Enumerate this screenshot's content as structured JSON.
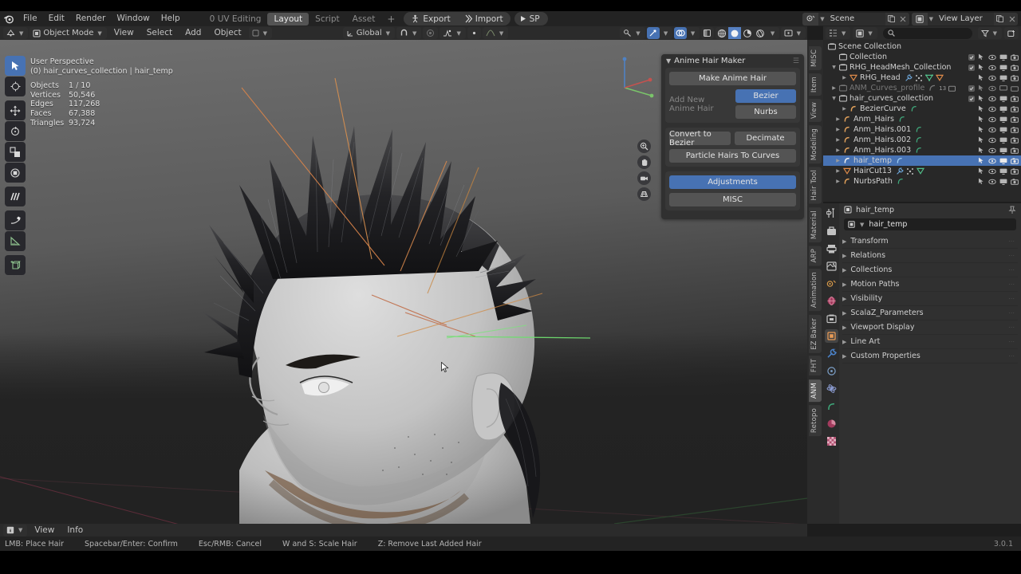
{
  "app": {
    "name": "Blender",
    "version": "3.0.1"
  },
  "topbar": {
    "logo_icon": "blender-logo-icon",
    "menus": [
      "File",
      "Edit",
      "Render",
      "Window",
      "Help"
    ],
    "workspace_tabs": [
      {
        "label": "0 UV Editing",
        "active": false
      },
      {
        "label": "Layout",
        "active": true
      },
      {
        "label": "Script",
        "active": false
      },
      {
        "label": "Asset",
        "active": false
      }
    ],
    "add_workspace": "+",
    "export_label": "Export",
    "import_label": "Import",
    "sp_label": "SP",
    "scene": {
      "label": "Scene",
      "icon": "scene-icon",
      "new_icon": "duplicate-icon",
      "unlink_icon": "close-icon"
    },
    "view_layer": {
      "label": "View Layer",
      "icon": "view-layer-icon",
      "new_icon": "duplicate-icon",
      "unlink_icon": "close-icon"
    }
  },
  "viewheader": {
    "editor_type_icon": "editor-type-icon",
    "mode": "Object Mode",
    "menus": [
      "View",
      "Select",
      "Add",
      "Object"
    ],
    "transform_orientation": "Global",
    "snap_icon": "magnet-icon",
    "proportional_icon": "proportional-edit-icon",
    "proportional_falloff_icon": "falloff-icon",
    "visibility_icon": "visibility-icon",
    "gizmo_icon": "gizmo-icon",
    "overlays_icon": "overlays-icon",
    "xray_icon": "xray-icon",
    "shading": [
      "wireframe",
      "solid",
      "material-preview",
      "rendered"
    ],
    "shading_active": "solid"
  },
  "viewport": {
    "perspective": "User Perspective",
    "context": "(0) hair_curves_collection | hair_temp",
    "stats": [
      {
        "label": "Objects",
        "value": "1 / 10"
      },
      {
        "label": "Vertices",
        "value": "50,546"
      },
      {
        "label": "Edges",
        "value": "117,268"
      },
      {
        "label": "Faces",
        "value": "67,388"
      },
      {
        "label": "Triangles",
        "value": "93,724"
      }
    ],
    "tools": [
      "tweak-select-tool",
      "cursor-tool",
      "move-tool",
      "rotate-tool",
      "scale-tool",
      "transform-tool",
      "annotate-tool",
      "measure-tool",
      "ruler-tool",
      "add-cube-tool"
    ],
    "nav_buttons": [
      "zoom-icon",
      "pan-hand-icon",
      "camera-view-icon",
      "toggle-perspective-icon"
    ],
    "gizmo_axes": [
      "x",
      "y",
      "z"
    ]
  },
  "vtabs": {
    "items": [
      {
        "label": "MISC",
        "active": false
      },
      {
        "label": "Item",
        "active": false
      },
      {
        "label": "View",
        "active": false
      },
      {
        "label": "Modeling",
        "active": false
      },
      {
        "label": "Hair Tool",
        "active": false
      },
      {
        "label": "Material",
        "active": false
      },
      {
        "label": "ARP",
        "active": false
      },
      {
        "label": "Animation",
        "active": false
      },
      {
        "label": "EZ Baker",
        "active": false
      },
      {
        "label": "FHT",
        "active": false
      },
      {
        "label": "ANM",
        "active": true
      },
      {
        "label": "Retopo",
        "active": false
      }
    ]
  },
  "anime_hair_maker": {
    "title": "Anime Hair Maker",
    "collapse_icon": "chevron-down-icon",
    "grip_icon": "grip-icon",
    "make_anime_hair": "Make Anime Hair",
    "add_new_anime_hair": "Add New Anime Hair",
    "bezier": "Bezier",
    "nurbs": "Nurbs",
    "convert_to_bezier": "Convert to Bezier",
    "decimate": "Decimate",
    "particle_hairs_to_curves": "Particle Hairs To Curves",
    "adjustments": "Adjustments",
    "misc": "MISC",
    "accent_color": "#4772b3"
  },
  "outliner": {
    "display_mode_icon": "outliner-display-mode-icon",
    "filter_id_icon": "filter-id-icon",
    "search_placeholder": "",
    "search_icon": "search-icon",
    "filter_icon": "filter-funnel-icon",
    "new_collection_icon": "new-collection-icon",
    "rows": [
      {
        "name": "Scene Collection",
        "indent": 0,
        "icon": "collection-icon",
        "tri": "",
        "checkbox": false,
        "selected": false,
        "dim": false,
        "extras": [],
        "rights": []
      },
      {
        "name": "Collection",
        "indent": 1,
        "icon": "collection-icon",
        "tri": "",
        "checkbox": true,
        "selected": false,
        "dim": false,
        "extras": [],
        "rights": [
          "cursor-arrow-icon",
          "eye-icon",
          "screen-icon",
          "camera-icon"
        ]
      },
      {
        "name": "RHG_HeadMesh_Collection",
        "indent": 1,
        "icon": "collection-icon",
        "tri": "down",
        "checkbox": true,
        "selected": false,
        "dim": false,
        "extras": [],
        "rights": [
          "cursor-arrow-icon",
          "eye-icon",
          "screen-icon",
          "camera-icon"
        ]
      },
      {
        "name": "RHG_Head",
        "indent": 2,
        "icon": "mesh-tri-icon",
        "tri": "right",
        "checkbox": false,
        "selected": false,
        "dim": false,
        "extras": [
          "modifier-wrench-icon",
          "particles-icon",
          "mesh-data-icon",
          "mesh-tri-icon"
        ],
        "rights": [
          "cursor-arrow-icon",
          "eye-icon",
          "screen-icon",
          "camera-icon"
        ]
      },
      {
        "name": "ANM_Curves_profile",
        "indent": 1,
        "icon": "collection-icon",
        "tri": "right",
        "checkbox": true,
        "selected": false,
        "dim": true,
        "extras": [
          "curve-icon",
          "count-13",
          "collection-small-icon"
        ],
        "rights": [
          "cursor-arrow-icon",
          "eye-icon",
          "screen-icon",
          "camera-icon"
        ]
      },
      {
        "name": "hair_curves_collection",
        "indent": 1,
        "icon": "collection-icon",
        "tri": "down",
        "checkbox": true,
        "selected": false,
        "dim": false,
        "extras": [],
        "rights": [
          "cursor-arrow-icon",
          "eye-icon",
          "screen-icon",
          "camera-icon"
        ]
      },
      {
        "name": "BezierCurve",
        "indent": 2,
        "icon": "curve-icon",
        "tri": "right",
        "checkbox": false,
        "selected": false,
        "dim": false,
        "extras": [
          "curve-data-icon"
        ],
        "rights": [
          "cursor-arrow-icon",
          "eye-icon",
          "screen-icon",
          "camera-icon"
        ]
      },
      {
        "name": "Anm_Hairs",
        "indent": 2,
        "icon": "curve-icon",
        "tri": "right",
        "checkbox": false,
        "selected": false,
        "dim": false,
        "extras": [
          "curve-data-icon"
        ],
        "rights": [
          "cursor-arrow-icon",
          "eye-icon",
          "screen-icon",
          "camera-icon"
        ]
      },
      {
        "name": "Anm_Hairs.001",
        "indent": 2,
        "icon": "curve-icon",
        "tri": "right",
        "checkbox": false,
        "selected": false,
        "dim": false,
        "extras": [
          "curve-data-icon"
        ],
        "rights": [
          "cursor-arrow-icon",
          "eye-icon",
          "screen-icon",
          "camera-icon"
        ]
      },
      {
        "name": "Anm_Hairs.002",
        "indent": 2,
        "icon": "curve-icon",
        "tri": "right",
        "checkbox": false,
        "selected": false,
        "dim": false,
        "extras": [
          "curve-data-icon"
        ],
        "rights": [
          "cursor-arrow-icon",
          "eye-icon",
          "screen-icon",
          "camera-icon"
        ]
      },
      {
        "name": "Anm_Hairs.003",
        "indent": 2,
        "icon": "curve-icon",
        "tri": "right",
        "checkbox": false,
        "selected": false,
        "dim": false,
        "extras": [
          "curve-data-icon"
        ],
        "rights": [
          "cursor-arrow-icon",
          "eye-icon",
          "screen-icon",
          "camera-icon"
        ]
      },
      {
        "name": "hair_temp",
        "indent": 2,
        "icon": "curve-icon",
        "tri": "right",
        "checkbox": false,
        "selected": true,
        "dim": false,
        "extras": [
          "curve-data-icon"
        ],
        "rights": [
          "cursor-arrow-icon",
          "eye-icon",
          "screen-icon",
          "camera-icon"
        ]
      },
      {
        "name": "HairCut13",
        "indent": 2,
        "icon": "mesh-tri-icon",
        "tri": "right",
        "checkbox": false,
        "selected": false,
        "dim": false,
        "extras": [
          "modifier-wrench-icon",
          "particles-icon",
          "mesh-data-icon"
        ],
        "rights": [
          "cursor-arrow-icon",
          "eye-icon",
          "screen-icon",
          "camera-icon"
        ]
      },
      {
        "name": "NurbsPath",
        "indent": 2,
        "icon": "curve-icon",
        "tri": "right",
        "checkbox": false,
        "selected": false,
        "dim": false,
        "extras": [
          "curve-data-icon"
        ],
        "rights": [
          "cursor-arrow-icon",
          "eye-icon",
          "screen-icon",
          "camera-icon"
        ]
      }
    ]
  },
  "properties": {
    "tabs": [
      {
        "icon": "tool-icon",
        "active": false
      },
      {
        "icon": "render-icon",
        "active": false
      },
      {
        "icon": "output-icon",
        "active": false
      },
      {
        "icon": "view-layer-icon",
        "active": false
      },
      {
        "icon": "scene-icon",
        "active": false
      },
      {
        "icon": "world-icon",
        "active": false
      },
      {
        "icon": "collection-properties-icon",
        "active": false
      },
      {
        "icon": "object-properties-icon",
        "active": true
      },
      {
        "icon": "modifier-wrench-icon",
        "active": false
      },
      {
        "icon": "particles-icon",
        "active": false
      },
      {
        "icon": "physics-icon",
        "active": false
      },
      {
        "icon": "object-constraints-icon",
        "active": false
      },
      {
        "icon": "object-data-curve-icon",
        "active": false
      },
      {
        "icon": "material-icon",
        "active": false
      },
      {
        "icon": "texture-icon",
        "active": false
      }
    ],
    "breadcrumb": "hair_temp",
    "breadcrumb_icon": "object-properties-icon",
    "pin_icon": "pin-icon",
    "name_field": "hair_temp",
    "name_field_icon": "object-properties-icon",
    "panels": [
      "Transform",
      "Relations",
      "Collections",
      "Motion Paths",
      "Visibility",
      "ScalaZ_Parameters",
      "Viewport Display",
      "Line Art",
      "Custom Properties"
    ]
  },
  "infobar": {
    "editor_icon": "info-editor-icon",
    "menus": [
      "View",
      "Info"
    ]
  },
  "statusbar": {
    "hints": [
      "LMB: Place Hair",
      "Spacebar/Enter: Confirm",
      "Esc/RMB: Cancel",
      "W and S: Scale Hair",
      "Z: Remove Last Added Hair"
    ],
    "version": "3.0.1"
  }
}
